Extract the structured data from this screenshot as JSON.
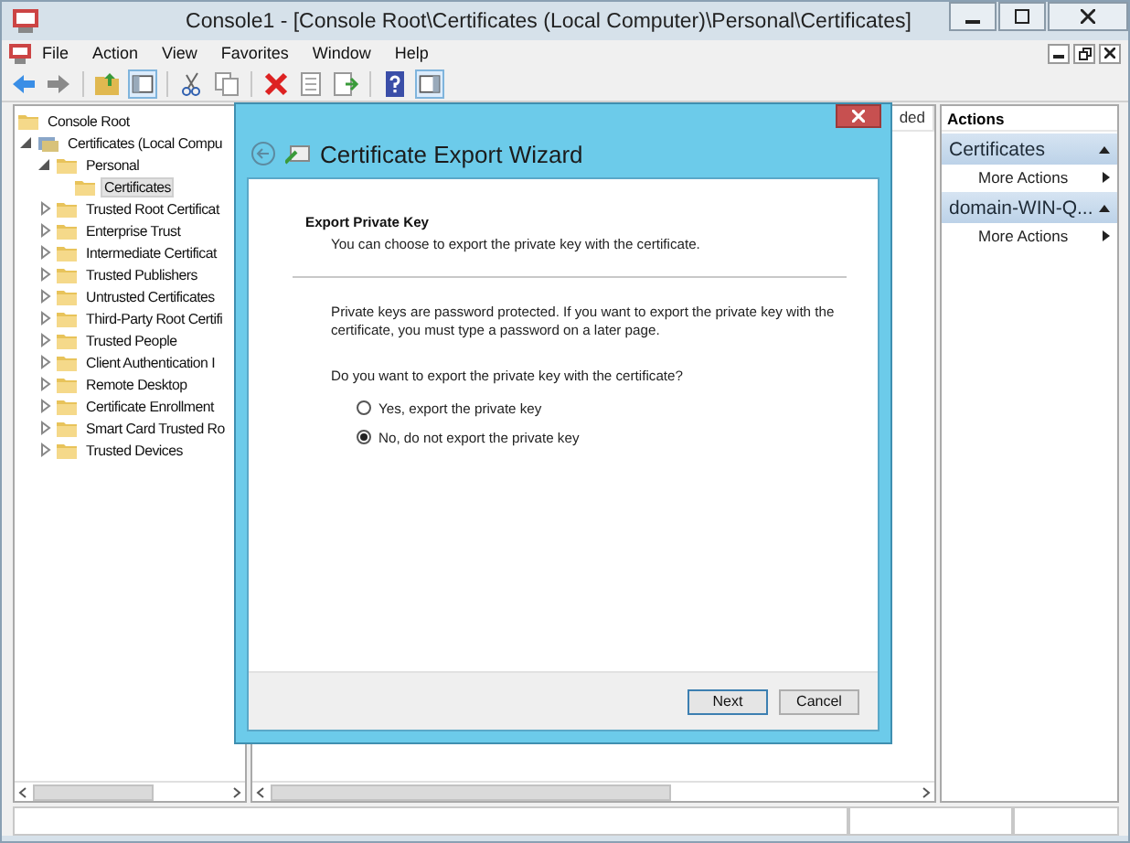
{
  "window": {
    "title": "Console1 - [Console Root\\Certificates (Local Computer)\\Personal\\Certificates]"
  },
  "menu": [
    "File",
    "Action",
    "View",
    "Favorites",
    "Window",
    "Help"
  ],
  "tree": [
    {
      "label": "Console Root",
      "selected": false,
      "children": [
        {
          "label": "Certificates (Local Compu",
          "selected": false,
          "expanded": true,
          "children": [
            {
              "label": "Personal",
              "selected": false,
              "expanded": true,
              "children": [
                {
                  "label": "Certificates",
                  "selected": true
                }
              ]
            },
            {
              "label": "Trusted Root Certificat",
              "selected": false,
              "expanded": false
            },
            {
              "label": "Enterprise Trust",
              "selected": false,
              "expanded": false
            },
            {
              "label": "Intermediate Certificat",
              "selected": false,
              "expanded": false
            },
            {
              "label": "Trusted Publishers",
              "selected": false,
              "expanded": false
            },
            {
              "label": "Untrusted Certificates",
              "selected": false,
              "expanded": false
            },
            {
              "label": "Third-Party Root Certifi",
              "selected": false,
              "expanded": false
            },
            {
              "label": "Trusted People",
              "selected": false,
              "expanded": false
            },
            {
              "label": "Client Authentication I",
              "selected": false,
              "expanded": false
            },
            {
              "label": "Remote Desktop",
              "selected": false,
              "expanded": false
            },
            {
              "label": "Certificate Enrollment",
              "selected": false,
              "expanded": false
            },
            {
              "label": "Smart Card Trusted Ro",
              "selected": false,
              "expanded": false
            },
            {
              "label": "Trusted Devices",
              "selected": false,
              "expanded": false
            }
          ]
        }
      ]
    }
  ],
  "center_pane": {
    "column_header": "ded"
  },
  "actions": {
    "title": "Actions",
    "sections": [
      {
        "title": "Certificates",
        "items": [
          "More Actions"
        ]
      },
      {
        "title": "domain-WIN-Q...",
        "items": [
          "More Actions"
        ]
      }
    ]
  },
  "dialog": {
    "title": "Certificate Export Wizard",
    "heading": "Export Private Key",
    "subheading": "You can choose to export the private key with the certificate.",
    "body": "Private keys are password protected. If you want to export the private key with the certificate, you must type a password on a later page.",
    "question": "Do you want to export the private key with the certificate?",
    "options": [
      {
        "label": "Yes, export the private key",
        "selected": false
      },
      {
        "label": "No, do not export the private key",
        "selected": true
      }
    ],
    "buttons": [
      {
        "label": "Next",
        "default": true
      },
      {
        "label": "Cancel",
        "default": false
      }
    ]
  }
}
